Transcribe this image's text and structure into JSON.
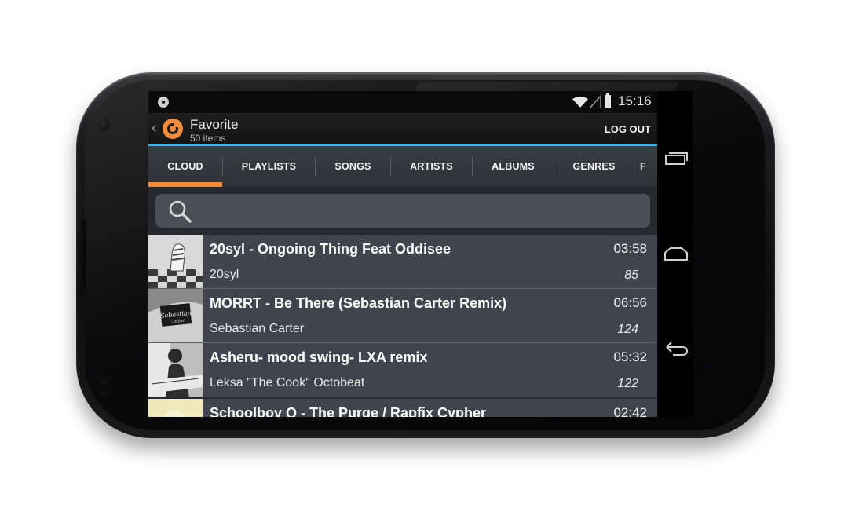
{
  "status_bar": {
    "time": "15:16"
  },
  "action_bar": {
    "title": "Favorite",
    "subtitle": "50 items",
    "logout_label": "LOG OUT",
    "accent_color": "#33b5e5",
    "logo_color": "#f08a3c"
  },
  "tabs": [
    {
      "label": "CLOUD",
      "selected": true
    },
    {
      "label": "PLAYLISTS",
      "selected": false
    },
    {
      "label": "SONGS",
      "selected": false
    },
    {
      "label": "ARTISTS",
      "selected": false
    },
    {
      "label": "ALBUMS",
      "selected": false
    },
    {
      "label": "GENRES",
      "selected": false
    },
    {
      "label": "F",
      "selected": false
    }
  ],
  "tab_indicator_color": "#f08a3c",
  "search": {
    "placeholder": "",
    "icon": "search-icon"
  },
  "tracks": [
    {
      "title": "20syl - Ongoing Thing Feat Oddisee",
      "artist": "20syl",
      "duration": "03:58",
      "count": "85"
    },
    {
      "title": "MORRT -  Be There (Sebastian Carter Remix)",
      "artist": "Sebastian Carter",
      "duration": "06:56",
      "count": "124"
    },
    {
      "title": "Asheru- mood swing- LXA remix",
      "artist": "Leksa \"The Cook\" Octobeat",
      "duration": "05:32",
      "count": "122"
    },
    {
      "title": "Schoolboy Q - The Purge / Rapfix Cypher",
      "artist": "",
      "duration": "02:42",
      "count": ""
    }
  ],
  "nav_buttons": [
    "recent-apps-icon",
    "home-icon",
    "back-icon"
  ]
}
